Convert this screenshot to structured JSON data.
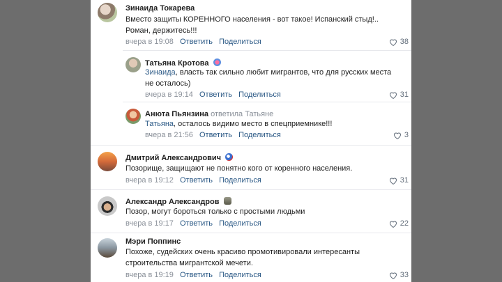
{
  "comments": [
    {
      "author": "Зинаида Токарева",
      "lines": [
        "Вместо защиты КОРЕННОГО населения - вот такое! Испанский стыд!..",
        "Роман, держитесь!!!"
      ],
      "time": "вчера в 19:08",
      "reply_label": "Ответить",
      "share_label": "Поделиться",
      "likes": "38"
    },
    {
      "author": "Татьяна Кротова",
      "mention": "Зинаида",
      "lines": [
        ", власть так сильно любит мигрантов, что для русских места",
        "не осталось)"
      ],
      "time": "вчера в 19:14",
      "reply_label": "Ответить",
      "share_label": "Поделиться",
      "likes": "31"
    },
    {
      "author": "Анюта Пьянзина",
      "reply_note": "ответила Татьяне",
      "mention": "Татьяна",
      "lines": [
        ", осталось видимо место в спецприемнике!!!"
      ],
      "time": "вчера в 21:56",
      "reply_label": "Ответить",
      "share_label": "Поделиться",
      "likes": "3"
    },
    {
      "author": "Дмитрий Александрович",
      "lines": [
        "Позорище, защищают не понятно кого от коренного населения."
      ],
      "time": "вчера в 19:12",
      "reply_label": "Ответить",
      "share_label": "Поделиться",
      "likes": "31"
    },
    {
      "author": "Александр Александров",
      "lines": [
        "Позор, могут бороться только с простыми людьми"
      ],
      "time": "вчера в 19:17",
      "reply_label": "Ответить",
      "share_label": "Поделиться",
      "likes": "22"
    },
    {
      "author": "Мэри Поппинс",
      "lines": [
        "Похоже, судейских очень красиво промотивировали интересанты",
        "строительства мигрантской мечети."
      ],
      "time": "вчера в 19:19",
      "reply_label": "Ответить",
      "share_label": "Поделиться",
      "likes": "33"
    }
  ],
  "colors": {
    "link": "#2a5885",
    "meta": "#8a9099",
    "text": "#222222",
    "outer": "#6d6d6d"
  }
}
